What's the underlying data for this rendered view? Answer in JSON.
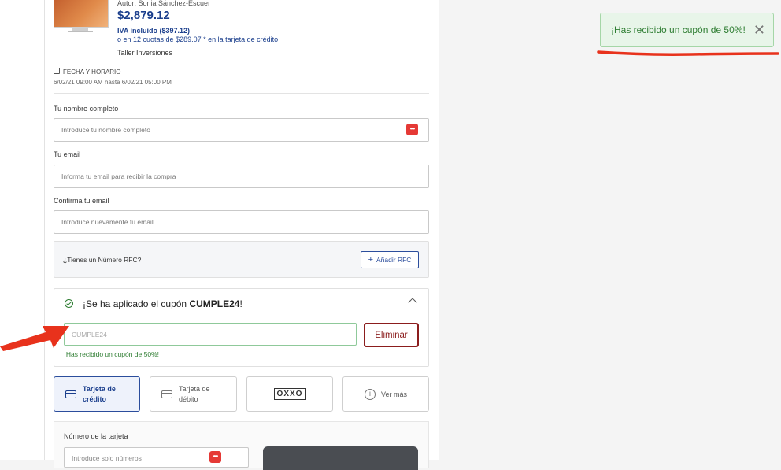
{
  "product": {
    "author": "Autor: Sonia Sánchez-Escuer",
    "price": "$2,879.12",
    "iva": "IVA incluido ($397.12)",
    "installments": "o en 12 cuotas de $289.07 * en la tarjeta de crédito",
    "vendor": "Taller Inversiones"
  },
  "schedule": {
    "label": "FECHA Y HORARIO",
    "value": "6/02/21 09:00 AM hasta 6/02/21 05:00 PM"
  },
  "form": {
    "name_label": "Tu nombre completo",
    "name_placeholder": "Introduce tu nombre completo",
    "email_label": "Tu email",
    "email_placeholder": "Informa tu email para recibir la compra",
    "confirm_label": "Confirma tu email",
    "confirm_placeholder": "Introduce nuevamente tu email"
  },
  "rfc": {
    "question": "¿Tienes un Número RFC?",
    "button": "Añadir RFC"
  },
  "coupon": {
    "title_prefix": "¡Se ha aplicado el cupón ",
    "code": "CUMPLE24",
    "title_suffix": "!",
    "input_value": "CUMPLE24",
    "remove_button": "Eliminar",
    "message": "¡Has recibido un cupón de 50%!"
  },
  "payment_methods": [
    {
      "label": "Tarjeta de crédito",
      "selected": true
    },
    {
      "label": "Tarjeta de débito",
      "selected": false
    },
    {
      "label": "OXXO",
      "selected": false
    },
    {
      "label": "Ver más",
      "selected": false
    }
  ],
  "card": {
    "number_label": "Número de la tarjeta",
    "number_placeholder": "Introduce solo números"
  },
  "toast": {
    "message": "¡Has recibido un cupón de 50%!",
    "close": "✕"
  },
  "icons": {
    "password_manager": "password-manager-icon",
    "calendar": "calendar-icon",
    "check": "check-circle-icon",
    "chevron": "chevron-up-icon",
    "card": "credit-card-icon",
    "plus": "plus-circle-icon"
  },
  "colors": {
    "brand_blue": "#1a3e8c",
    "success_green": "#2e7d32",
    "remove_red": "#8b1d1d",
    "annotation_red": "#e8321c"
  }
}
